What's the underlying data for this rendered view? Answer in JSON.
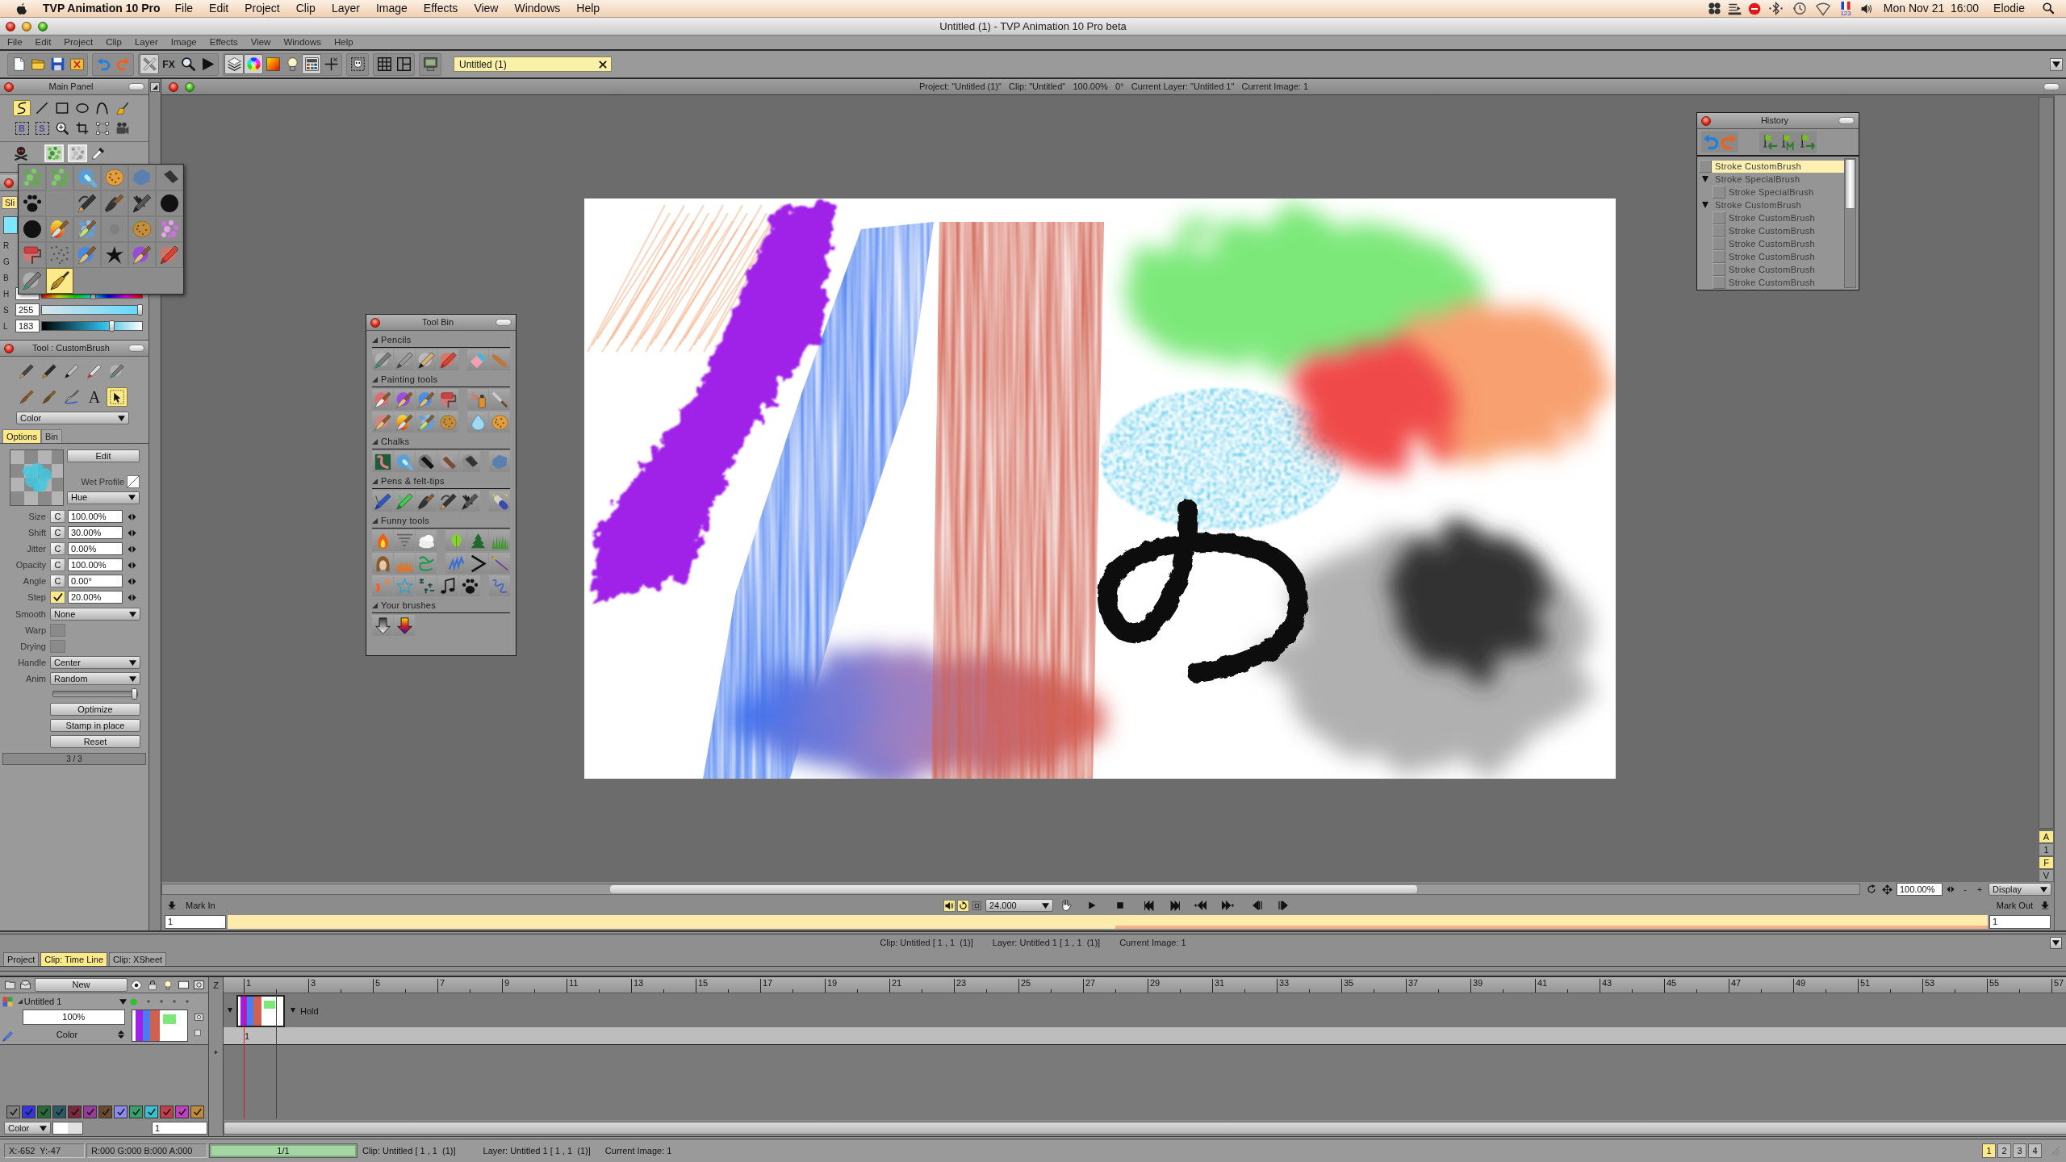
{
  "menubar": {
    "app_name": "TVP Animation 10 Pro",
    "menus": [
      "File",
      "Edit",
      "Project",
      "Clip",
      "Layer",
      "Image",
      "Effects",
      "View",
      "Windows",
      "Help"
    ],
    "input_source": "123",
    "clock": "Mon Nov 21  16:00",
    "user": "Elodie"
  },
  "window": {
    "title": "Untitled (1) - TVP Animation 10 Pro beta"
  },
  "app_menu": [
    "File",
    "Edit",
    "Project",
    "Clip",
    "Layer",
    "Image",
    "Effects",
    "View",
    "Windows",
    "Help"
  ],
  "toolbar": {
    "groups": [
      [
        {
          "kind": "new",
          "on": false
        },
        {
          "kind": "open",
          "on": false
        },
        {
          "kind": "save",
          "on": false
        },
        {
          "kind": "closefile",
          "on": false
        }
      ],
      [
        {
          "kind": "undo",
          "on": false
        },
        {
          "kind": "redo",
          "on": false
        }
      ],
      [
        {
          "kind": "brushes",
          "on": true
        },
        {
          "kind": "fx",
          "label": "FX",
          "on": false
        },
        {
          "kind": "search",
          "on": false
        },
        {
          "kind": "play",
          "on": false
        }
      ],
      [
        {
          "kind": "layers",
          "on": true
        },
        {
          "kind": "wheel",
          "on": true
        },
        {
          "kind": "gradient",
          "on": false
        },
        {
          "kind": "bulb",
          "on": false
        },
        {
          "kind": "panel",
          "on": true
        },
        {
          "kind": "crosshair",
          "on": false
        }
      ],
      [
        {
          "kind": "face",
          "on": false
        }
      ],
      [
        {
          "kind": "grid",
          "on": false
        },
        {
          "kind": "layout",
          "on": false
        }
      ],
      [
        {
          "kind": "monitor",
          "on": false
        }
      ]
    ],
    "document_tab": "Untitled (1)"
  },
  "main_panel": {
    "title": "Main Panel",
    "tools": [
      {
        "kind": "freehand",
        "selected": true
      },
      {
        "kind": "line",
        "selected": false
      },
      {
        "kind": "rectangle",
        "selected": false
      },
      {
        "kind": "ellipse",
        "selected": false
      },
      {
        "kind": "bezier",
        "selected": false
      },
      {
        "kind": "glove",
        "selected": false
      },
      {
        "kind": "select",
        "letter": "B",
        "selected": false
      },
      {
        "kind": "select",
        "letter": "S",
        "selected": false
      },
      {
        "kind": "zoom",
        "selected": false
      },
      {
        "kind": "crop",
        "selected": false
      },
      {
        "kind": "transform",
        "selected": false
      },
      {
        "kind": "camera",
        "selected": false
      }
    ]
  },
  "color_panel": {
    "tabs": [
      {
        "label": "Sli",
        "selected": true
      }
    ],
    "channels": [
      {
        "label": "R"
      },
      {
        "label": "G"
      },
      {
        "label": "B"
      },
      {
        "kind": "hue",
        "label": "H",
        "level": 0.52
      },
      {
        "kind": "saturation",
        "label": "S",
        "value": "255",
        "level": 0.98
      },
      {
        "kind": "lightness",
        "label": "L",
        "value": "183",
        "level": 0.7
      }
    ]
  },
  "brush_popup": [
    {
      "kind": "greenspray",
      "selected": false
    },
    {
      "kind": "greenspray",
      "selected": false
    },
    {
      "kind": "airbrush",
      "selected": false
    },
    {
      "kind": "sponge",
      "selected": false
    },
    {
      "kind": "stone",
      "selected": false
    },
    {
      "kind": "chalk",
      "selected": false
    },
    {
      "kind": "paw",
      "selected": false
    },
    {
      "kind": "empty"
    },
    {
      "kind": "hook",
      "selected": false
    },
    {
      "kind": "inkbrush",
      "selected": false
    },
    {
      "kind": "scrawl",
      "selected": false
    },
    {
      "kind": "blackblot",
      "selected": false
    },
    {
      "kind": "blackblot",
      "selected": false
    },
    {
      "kind": "rainbowbrush",
      "selected": false
    },
    {
      "kind": "spotbrush",
      "selected": false
    },
    {
      "kind": "blur",
      "selected": false
    },
    {
      "kind": "greensponge",
      "selected": false
    },
    {
      "kind": "pinkspray",
      "selected": false
    },
    {
      "kind": "roller",
      "selected": false
    },
    {
      "kind": "speckle",
      "selected": false
    },
    {
      "kind": "bluebrush",
      "selected": false
    },
    {
      "kind": "splat",
      "selected": false
    },
    {
      "kind": "violetbrush",
      "selected": false
    },
    {
      "kind": "crayon",
      "selected": false
    },
    {
      "kind": "pencil",
      "selected": false
    },
    {
      "kind": "pennib",
      "selected": true
    }
  ],
  "tool_panel": {
    "title": "Tool : CustomBrush",
    "tools": [
      {
        "kind": "brushpen",
        "selected": false
      },
      {
        "kind": "pen",
        "selected": false
      },
      {
        "kind": "inkpen",
        "selected": false
      },
      {
        "kind": "marker",
        "selected": false
      },
      {
        "kind": "pencil",
        "selected": false
      },
      {
        "kind": "flatbrush",
        "selected": false
      },
      {
        "kind": "brush",
        "selected": false
      },
      {
        "kind": "knife",
        "selected": false
      },
      {
        "kind": "text",
        "label": "A",
        "selected": false
      },
      {
        "kind": "pointer",
        "selected": true
      }
    ],
    "mode": "Color",
    "tabs": [
      {
        "label": "Options",
        "selected": true
      },
      {
        "label": "Bin",
        "selected": false
      }
    ],
    "edit": "Edit",
    "wet_profile": "Wet Profile",
    "profile": "Hue",
    "params": [
      {
        "label": "Size",
        "kind": "lock",
        "button": "C",
        "value": "100.00%"
      },
      {
        "label": "Shift",
        "kind": "lock",
        "button": "C",
        "value": "30.00%"
      },
      {
        "label": "Jitter",
        "kind": "lock",
        "button": "C",
        "value": "0.00%"
      },
      {
        "label": "Opacity",
        "kind": "lock",
        "button": "C",
        "value": "100.00%"
      },
      {
        "label": "Angle",
        "kind": "lock",
        "button": "C",
        "value": "0.00°"
      },
      {
        "label": "Step",
        "kind": "check",
        "checked": true,
        "value": "20.00%"
      }
    ],
    "smooth": {
      "label": "Smooth",
      "value": "None"
    },
    "toggles": [
      {
        "label": "Warp",
        "checked": false
      },
      {
        "label": "Drying",
        "checked": false
      }
    ],
    "handle": {
      "label": "Handle",
      "value": "Center"
    },
    "anim": {
      "label": "Anim",
      "value": "Random"
    },
    "level": 0.97,
    "buttons": [
      "Optimize",
      "Stamp in place",
      "Reset"
    ],
    "page": "3 / 3"
  },
  "view": {
    "info": "Project: \"Untitled (1)\"   Clip: \"Untitled\"   100.00%   0°   Current Layer: \"Untitled 1\"   Current Image: 1",
    "toggles": [
      {
        "label": "A",
        "on": true
      },
      {
        "label": "1",
        "on": false
      },
      {
        "label": "F",
        "on": true
      },
      {
        "label": "V",
        "on": false
      }
    ]
  },
  "tool_bin": {
    "title": "Tool Bin",
    "sections": [
      {
        "title": "Pencils",
        "expanded": true,
        "rows": [
          [
            [
              {
                "kind": "pencil"
              },
              {
                "kind": "graphite"
              },
              {
                "kind": "charcoal"
              },
              {
                "kind": "crayon"
              }
            ],
            [
              {
                "kind": "eraser"
              },
              {
                "kind": "finger"
              }
            ]
          ]
        ]
      },
      {
        "title": "Painting tools",
        "expanded": true,
        "rows": [
          [
            [
              {
                "kind": "redbrush"
              },
              {
                "kind": "violetbrush"
              },
              {
                "kind": "bluebrush"
              },
              {
                "kind": "roller"
              }
            ],
            [
              {
                "kind": "spraycan"
              },
              {
                "kind": "spatula"
              }
            ]
          ],
          [
            [
              {
                "kind": "pinkbrush"
              },
              {
                "kind": "rainbowbrush"
              },
              {
                "kind": "spotbrush"
              },
              {
                "kind": "greensponge"
              }
            ],
            [
              {
                "kind": "drop"
              },
              {
                "kind": "sponge"
              }
            ]
          ]
        ]
      },
      {
        "title": "Chalks",
        "expanded": true,
        "rows": [
          [
            [
              {
                "kind": "chalkboard"
              },
              {
                "kind": "airbrush"
              },
              {
                "kind": "charcoalstick"
              },
              {
                "kind": "pastel"
              },
              {
                "kind": "chalk"
              }
            ],
            [
              {
                "kind": "stone"
              }
            ]
          ]
        ]
      },
      {
        "title": "Pens & felt-tips",
        "expanded": true,
        "rows": [
          [
            [
              {
                "kind": "ballpen"
              },
              {
                "kind": "feltpen"
              },
              {
                "kind": "inkbrush"
              },
              {
                "kind": "hook"
              },
              {
                "kind": "scrawl"
              }
            ],
            [
              {
                "kind": "sparkle"
              }
            ]
          ]
        ]
      },
      {
        "title": "Funny tools",
        "expanded": true,
        "rows": [
          [
            [
              {
                "kind": "flame"
              },
              {
                "kind": "tornado"
              },
              {
                "kind": "cloud"
              }
            ],
            [
              {
                "kind": "leaf"
              },
              {
                "kind": "tree"
              },
              {
                "kind": "grass"
              }
            ]
          ],
          [
            [
              {
                "kind": "hair"
              },
              {
                "kind": "fur"
              },
              {
                "kind": "squiggle"
              }
            ],
            [
              {
                "kind": "spring"
              },
              {
                "kind": "chevron"
              },
              {
                "kind": "rainbow"
              }
            ]
          ],
          [
            [
              {
                "kind": "butterfly"
              },
              {
                "kind": "star"
              },
              {
                "kind": "glyphs"
              },
              {
                "kind": "notes"
              },
              {
                "kind": "paw"
              }
            ],
            [
              {
                "kind": "scribble"
              }
            ]
          ]
        ]
      },
      {
        "title": "Your brushes",
        "expanded": true,
        "rows": [
          [
            [
              {
                "kind": "arrow"
              },
              {
                "kind": "gradarrow"
              }
            ]
          ]
        ]
      }
    ]
  },
  "history": {
    "title": "History",
    "items": [
      {
        "label": "Stroke CustomBrush",
        "selected": true
      },
      {
        "label": "Stroke SpecialBrush",
        "selected": false,
        "expanded": true,
        "children": [
          {
            "label": "Stroke SpecialBrush",
            "selected": false
          }
        ]
      },
      {
        "label": "Stroke CustomBrush",
        "selected": false,
        "expanded": true,
        "children": [
          {
            "label": "Stroke CustomBrush",
            "selected": false
          },
          {
            "label": "Stroke CustomBrush",
            "selected": false
          },
          {
            "label": "Stroke CustomBrush",
            "selected": false
          },
          {
            "label": "Stroke CustomBrush",
            "selected": false
          },
          {
            "label": "Stroke CustomBrush",
            "selected": false
          },
          {
            "label": "Stroke CustomBrush",
            "selected": false
          }
        ]
      }
    ]
  },
  "transport": {
    "zoom": "100.00%",
    "zoom_steps": [
      "-",
      "+"
    ],
    "display": "Display",
    "mark_in": "Mark In",
    "toggles": [
      {
        "kind": "sound",
        "on": true
      },
      {
        "kind": "loop",
        "on": true
      },
      {
        "kind": "safe",
        "on": false
      }
    ],
    "fps": "24.000",
    "mark_out": "Mark Out",
    "start": "1",
    "end": "1"
  },
  "clip_info": [
    "Clip: Untitled [ 1 , 1  (1)]",
    "Layer: Untitled 1 [ 1 , 1  (1)]",
    "Current Image: 1"
  ],
  "bottom_tabs": [
    {
      "label": "Project",
      "selected": false
    },
    {
      "label": "Clip: Time Line",
      "selected": true
    },
    {
      "label": "Clip: XSheet",
      "selected": false
    }
  ],
  "timeline": {
    "new": "New",
    "column_letter": "Z",
    "ruler": [
      "1",
      "3",
      "5",
      "7",
      "9",
      "11",
      "13",
      "15",
      "17",
      "19",
      "21",
      "23",
      "25",
      "27",
      "29",
      "31",
      "33",
      "35",
      "37",
      "39",
      "41",
      "43",
      "45",
      "47",
      "49",
      "51",
      "53",
      "55",
      "57"
    ],
    "layer": {
      "name": "Untitled 1",
      "opacity": "100%",
      "mode": "Color",
      "hold": "Hold",
      "frame": "1"
    },
    "color_filters": [
      {
        "color": "#7e7e7e",
        "checked": true
      },
      {
        "color": "#3434e0",
        "checked": true
      },
      {
        "color": "#2a6a3a",
        "checked": true
      },
      {
        "color": "#2a5a66",
        "checked": true
      },
      {
        "color": "#7a2a3a",
        "checked": true
      },
      {
        "color": "#9a3a9a",
        "checked": true
      },
      {
        "color": "#6a4a2a",
        "checked": true
      },
      {
        "color": "#8a8af0",
        "checked": true
      },
      {
        "color": "#3aa06a",
        "checked": true
      },
      {
        "color": "#3ac0d0",
        "checked": true
      },
      {
        "color": "#c0404a",
        "checked": true
      },
      {
        "color": "#c040c0",
        "checked": true
      },
      {
        "color": "#c08a3a",
        "checked": true
      }
    ],
    "mode": "Color",
    "frame": "1"
  },
  "status_bar": {
    "coords": "X:-652  Y:-47",
    "rgba": "R:000 G:000 B:000 A:000",
    "progress": {
      "label": "1/1",
      "level": 1
    },
    "clip": "Clip: Untitled [ 1 , 1  (1)]",
    "layer": "Layer: Untitled 1 [ 1 , 1  (1)]",
    "image": "Current Image: 1",
    "pages": [
      {
        "label": "1",
        "selected": true
      },
      {
        "label": "2",
        "selected": false
      },
      {
        "label": "3",
        "selected": false
      },
      {
        "label": "4",
        "selected": false
      }
    ]
  }
}
